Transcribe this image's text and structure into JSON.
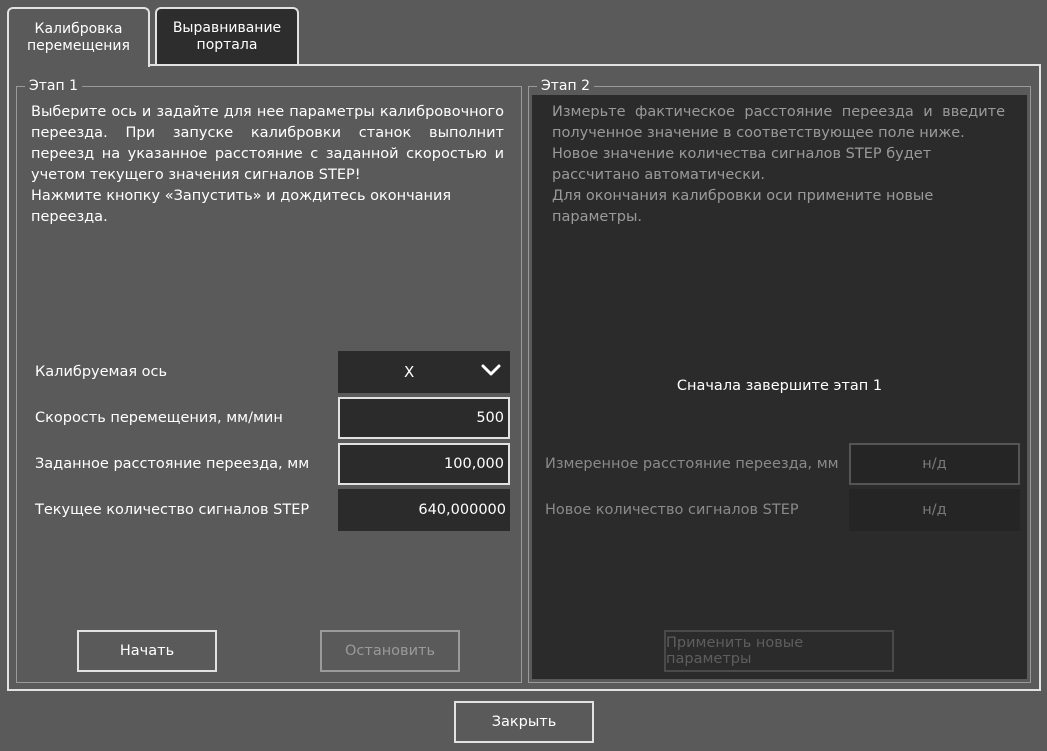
{
  "tabs": [
    {
      "label": "Калибровка\nперемещения",
      "active": true
    },
    {
      "label": "Выравнивание\nпортала",
      "active": false
    }
  ],
  "stage1": {
    "title": "Этап 1",
    "description": [
      "Выберите ось и задайте для нее параметры калибровочного переезда. При запуске калибровки станок выполнит переезд на указанное расстояние с заданной скоростью и учетом текущего значения сигналов STEP!",
      "Нажмите кнопку «Запустить» и дождитесь окончания переезда."
    ],
    "axis": {
      "label": "Калибруемая ось",
      "value": "X"
    },
    "speed": {
      "label": "Скорость перемещения, мм/мин",
      "value": "500"
    },
    "distance": {
      "label": "Заданное расстояние переезда, мм",
      "value": "100,000"
    },
    "step_count": {
      "label": "Текущее количество сигналов STEP",
      "value": "640,000000"
    },
    "start_button": "Начать",
    "stop_button": "Остановить"
  },
  "stage2": {
    "title": "Этап 2",
    "description": [
      "Измерьте фактическое расстояние переезда и введите полученное значение в соответствующее поле ниже.",
      "Новое значение количества сигналов STEP будет рассчитано автоматически.",
      "Для окончания калибровки оси примените новые параметры."
    ],
    "notice": "Сначала завершите этап 1",
    "measured": {
      "label": "Измеренное расстояние переезда, мм",
      "value": "н/д"
    },
    "new_step": {
      "label": "Новое количество сигналов STEP",
      "value": "н/д"
    },
    "apply_button": "Применить новые параметры"
  },
  "close_button": "Закрыть",
  "colors": {
    "background": "#5a5a5a",
    "panel_dark": "#2b2b2b",
    "border_light": "#e2e2e2",
    "text_dim": "#9a9a9a"
  },
  "icons": {
    "dropdown": "chevron-down-icon"
  }
}
